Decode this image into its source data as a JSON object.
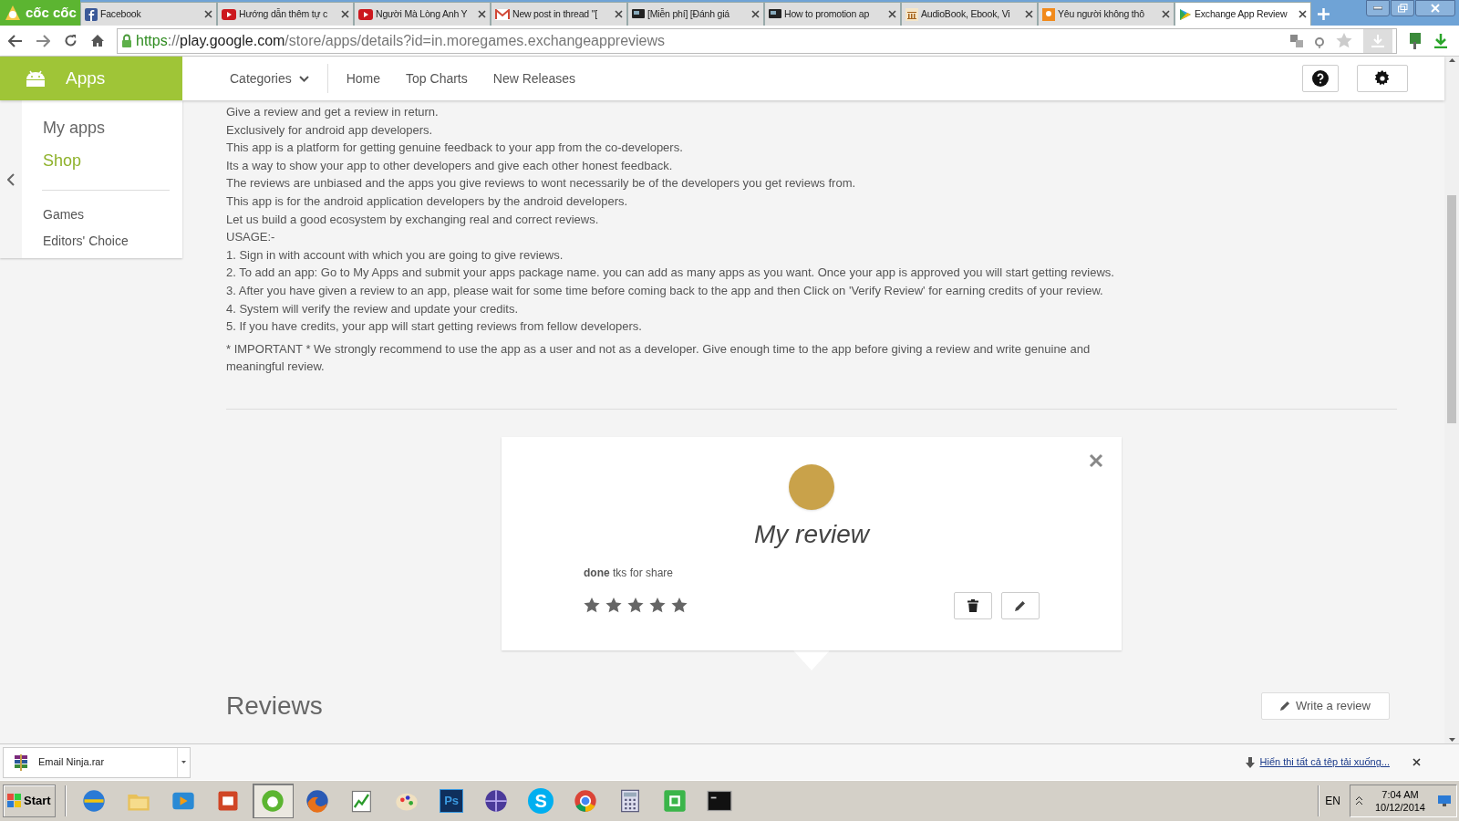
{
  "browser": {
    "logo": "cốc cốc",
    "tabs": [
      {
        "label": "Facebook",
        "kind": "facebook",
        "selected": false
      },
      {
        "label": "Hướng dẫn thêm tự c",
        "kind": "video",
        "selected": false
      },
      {
        "label": "Người Mà Lòng Anh Y",
        "kind": "video",
        "selected": false
      },
      {
        "label": "New post in thread \"[",
        "kind": "mail",
        "selected": false
      },
      {
        "label": "[Miễn phí] [Đánh giá",
        "kind": "monitor",
        "selected": false
      },
      {
        "label": "How to promotion ap",
        "kind": "monitor",
        "selected": false
      },
      {
        "label": "AudioBook, Ebook, Vi",
        "kind": "library",
        "selected": false
      },
      {
        "label": "Yêu người không thô",
        "kind": "orange",
        "selected": false
      },
      {
        "label": "Exchange App Review",
        "kind": "play",
        "selected": true
      }
    ],
    "url": {
      "scheme": "https",
      "separator": "://",
      "host": "play.google.com",
      "path": "/store/apps/details?id=in.moregames.exchangeappreviews"
    }
  },
  "header": {
    "section": "Apps",
    "nav": [
      {
        "label": "Categories",
        "kind": "dropdown"
      },
      {
        "label": "Home",
        "kind": "link"
      },
      {
        "label": "Top Charts",
        "kind": "link"
      },
      {
        "label": "New Releases",
        "kind": "link"
      }
    ]
  },
  "sidebar": {
    "items": [
      {
        "label": "My apps",
        "selected": false
      },
      {
        "label": "Shop",
        "selected": true
      }
    ],
    "links": [
      "Games",
      "Editors' Choice"
    ]
  },
  "description": [
    "Give a review and get a review in return.",
    "Exclusively for android app developers.",
    "This app is a platform for getting genuine feedback to your app from the co-developers.",
    "Its a way to show your app to other developers and give each other honest feedback.",
    "The reviews are unbiased and the apps you give reviews to wont necessarily be of the developers you get reviews from.",
    "This app is for the android application developers by the android developers.",
    "Let us build a good ecosystem by exchanging real and correct reviews.",
    "USAGE:-",
    "1. Sign in with account with which you are going to give reviews.",
    "2. To add an app: Go to My Apps and submit your apps package name. you can add as many apps as you want. Once your app is approved you will start getting reviews.",
    "3. After you have given a review to an app, please wait for some time before coming back to the app and then Click on 'Verify Review' for earning credits of your review.",
    "4. System will verify the review and update your credits.",
    "5. If you have credits, your app will start getting reviews from fellow developers."
  ],
  "important": "* IMPORTANT * We strongly recommend to use the app as a user and not as a developer. Give enough time to the app before giving a review and write genuine and meaningful review.",
  "my_review": {
    "title": "My review",
    "text": "**done** tks for share",
    "stars": 5
  },
  "reviews": {
    "title": "Reviews",
    "write_button": "Write a review"
  },
  "download_bar": {
    "file": "Email Ninja.rar",
    "show_all": "Hiển thị tất cả tệp tải xuống..."
  },
  "taskbar": {
    "start": "Start",
    "apps": [
      {
        "kind": "globe",
        "selected": false
      },
      {
        "kind": "folder",
        "selected": false
      },
      {
        "kind": "media",
        "selected": false
      },
      {
        "kind": "document",
        "selected": false
      },
      {
        "kind": "browser",
        "selected": true
      },
      {
        "kind": "fox",
        "selected": false
      },
      {
        "kind": "chart",
        "selected": false
      },
      {
        "kind": "palette",
        "selected": false
      },
      {
        "kind": "ps",
        "label": "Ps",
        "selected": false
      },
      {
        "kind": "orb",
        "selected": false
      },
      {
        "kind": "skype",
        "label": "S",
        "selected": false
      },
      {
        "kind": "chrome",
        "selected": false
      },
      {
        "kind": "calculator",
        "selected": false
      },
      {
        "kind": "capture",
        "selected": false
      },
      {
        "kind": "terminal",
        "selected": false
      }
    ],
    "language": "EN",
    "time": "7:04 AM",
    "date": "10/12/2014"
  }
}
